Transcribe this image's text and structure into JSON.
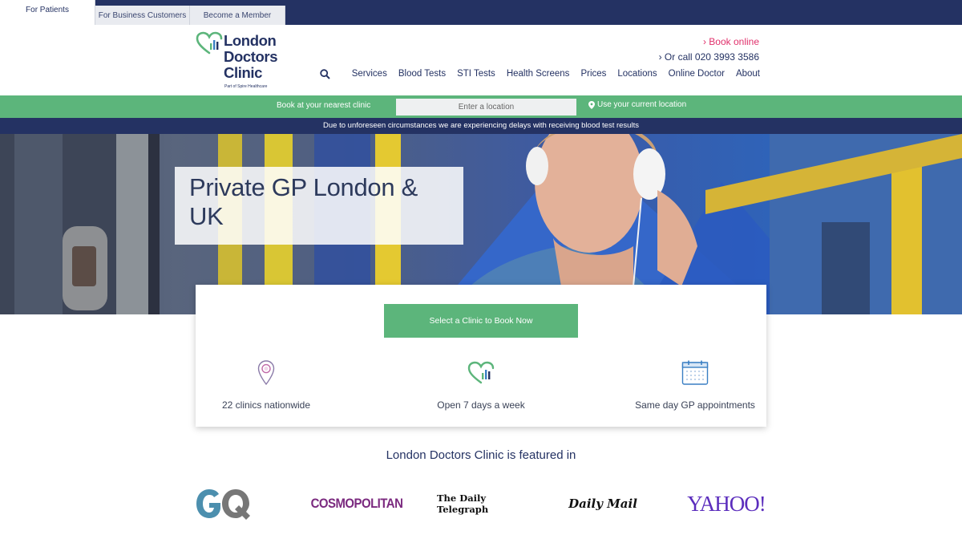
{
  "topbar": {
    "tabs": [
      {
        "label": "For Patients",
        "active": true
      },
      {
        "label": "For Business Customers",
        "active": false
      },
      {
        "label": "Become a Member",
        "active": false
      }
    ]
  },
  "header": {
    "logo_text": "London Doctors Clinic",
    "logo_line1": "London",
    "logo_line2": "Doctors",
    "logo_line3": "Clinic",
    "logo_sub": "Part of Spire Healthcare",
    "book_online": "Book online",
    "call": "Or call 020 3993 3586"
  },
  "nav": {
    "search_icon": "search-icon",
    "items": [
      "Services",
      "Blood Tests",
      "STI Tests",
      "Health Screens",
      "Prices",
      "Locations",
      "Online Doctor",
      "About"
    ]
  },
  "locbar": {
    "label": "Book at your nearest clinic",
    "input_placeholder": "Enter a location",
    "current_location": "Use your current location"
  },
  "notice": {
    "text": "Due to unforeseen circumstances we are experiencing delays with receiving blood test results"
  },
  "hero": {
    "title": "Private GP London & UK"
  },
  "card": {
    "cta_label": "Select a Clinic to Book Now",
    "features": [
      {
        "icon": "map-pin-icon",
        "label": "22 clinics nationwide"
      },
      {
        "icon": "heart-chart-icon",
        "label": "Open 7 days a week"
      },
      {
        "icon": "calendar-icon",
        "label": "Same day GP appointments"
      }
    ]
  },
  "featured": {
    "title": "London Doctors Clinic is featured in",
    "logos": [
      "GQ",
      "COSMOPOLITAN",
      "The Daily Telegraph",
      "Daily Mail",
      "YAHOO!"
    ]
  },
  "colors": {
    "navy": "#243263",
    "green": "#5cb57b",
    "pink": "#e0306b"
  }
}
